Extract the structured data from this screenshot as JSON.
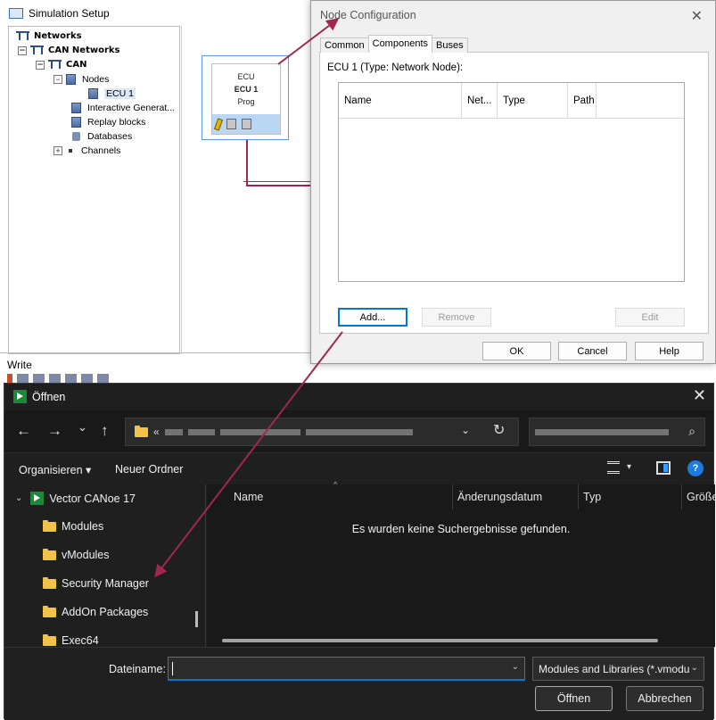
{
  "sim": {
    "title": "Simulation Setup",
    "tree": {
      "networks": "Networks",
      "can_networks": "CAN Networks",
      "can": "CAN",
      "nodes": "Nodes",
      "ecu1": "ECU 1",
      "interactive": "Interactive Generat...",
      "replay": "Replay blocks",
      "databases": "Databases",
      "channels": "Channels",
      "expanded_sign": "−",
      "collapsed_sign": "+"
    },
    "ecu_box": {
      "type_label": "ECU",
      "name": "ECU 1",
      "sub": "Prog"
    },
    "write_label": "Write"
  },
  "node_config": {
    "title": "Node Configuration",
    "close_glyph": "✕",
    "tabs": [
      "Common",
      "Components",
      "Buses"
    ],
    "active_tab": "Components",
    "ecu_label": "ECU 1 (Type: Network Node):",
    "columns": [
      "Name",
      "Net...",
      "Type",
      "Path"
    ],
    "buttons": {
      "add": "Add...",
      "remove": "Remove",
      "edit": "Edit",
      "ok": "OK",
      "cancel": "Cancel",
      "help": "Help"
    }
  },
  "open_dialog": {
    "title": "Öffnen",
    "close_glyph": "✕",
    "nav": {
      "back": "←",
      "forward": "→",
      "recent": "⌄",
      "up": "↑",
      "path_prefix": "«",
      "path_chevron": "⌄",
      "refresh": "↻",
      "search_icon": "⌕"
    },
    "toolbar": {
      "organize": "Organisieren ▾",
      "new_folder": "Neuer Ordner",
      "view_chevron": "▾",
      "help": "?"
    },
    "sidebar": [
      {
        "label": "Vector CANoe 17",
        "expanded_glyph": "⌄"
      },
      {
        "label": "Modules"
      },
      {
        "label": "vModules"
      },
      {
        "label": "Security Manager"
      },
      {
        "label": "AddOn Packages"
      },
      {
        "label": "Exec64"
      }
    ],
    "columns": [
      "Name",
      "Änderungsdatum",
      "Typ",
      "Größe"
    ],
    "sort_glyph": "^",
    "empty_message": "Es wurden keine Suchergebnisse gefunden.",
    "filename_label": "Dateiname:",
    "filename_value": "",
    "filter_value": "Modules and Libraries (*.vmodu",
    "chevron": "⌄",
    "buttons": {
      "open": "Öffnen",
      "cancel": "Abbrechen"
    }
  },
  "colors": {
    "arrow": "#a0284e",
    "accent": "#0078d4",
    "dialog_bg": "#1f1f1f"
  }
}
